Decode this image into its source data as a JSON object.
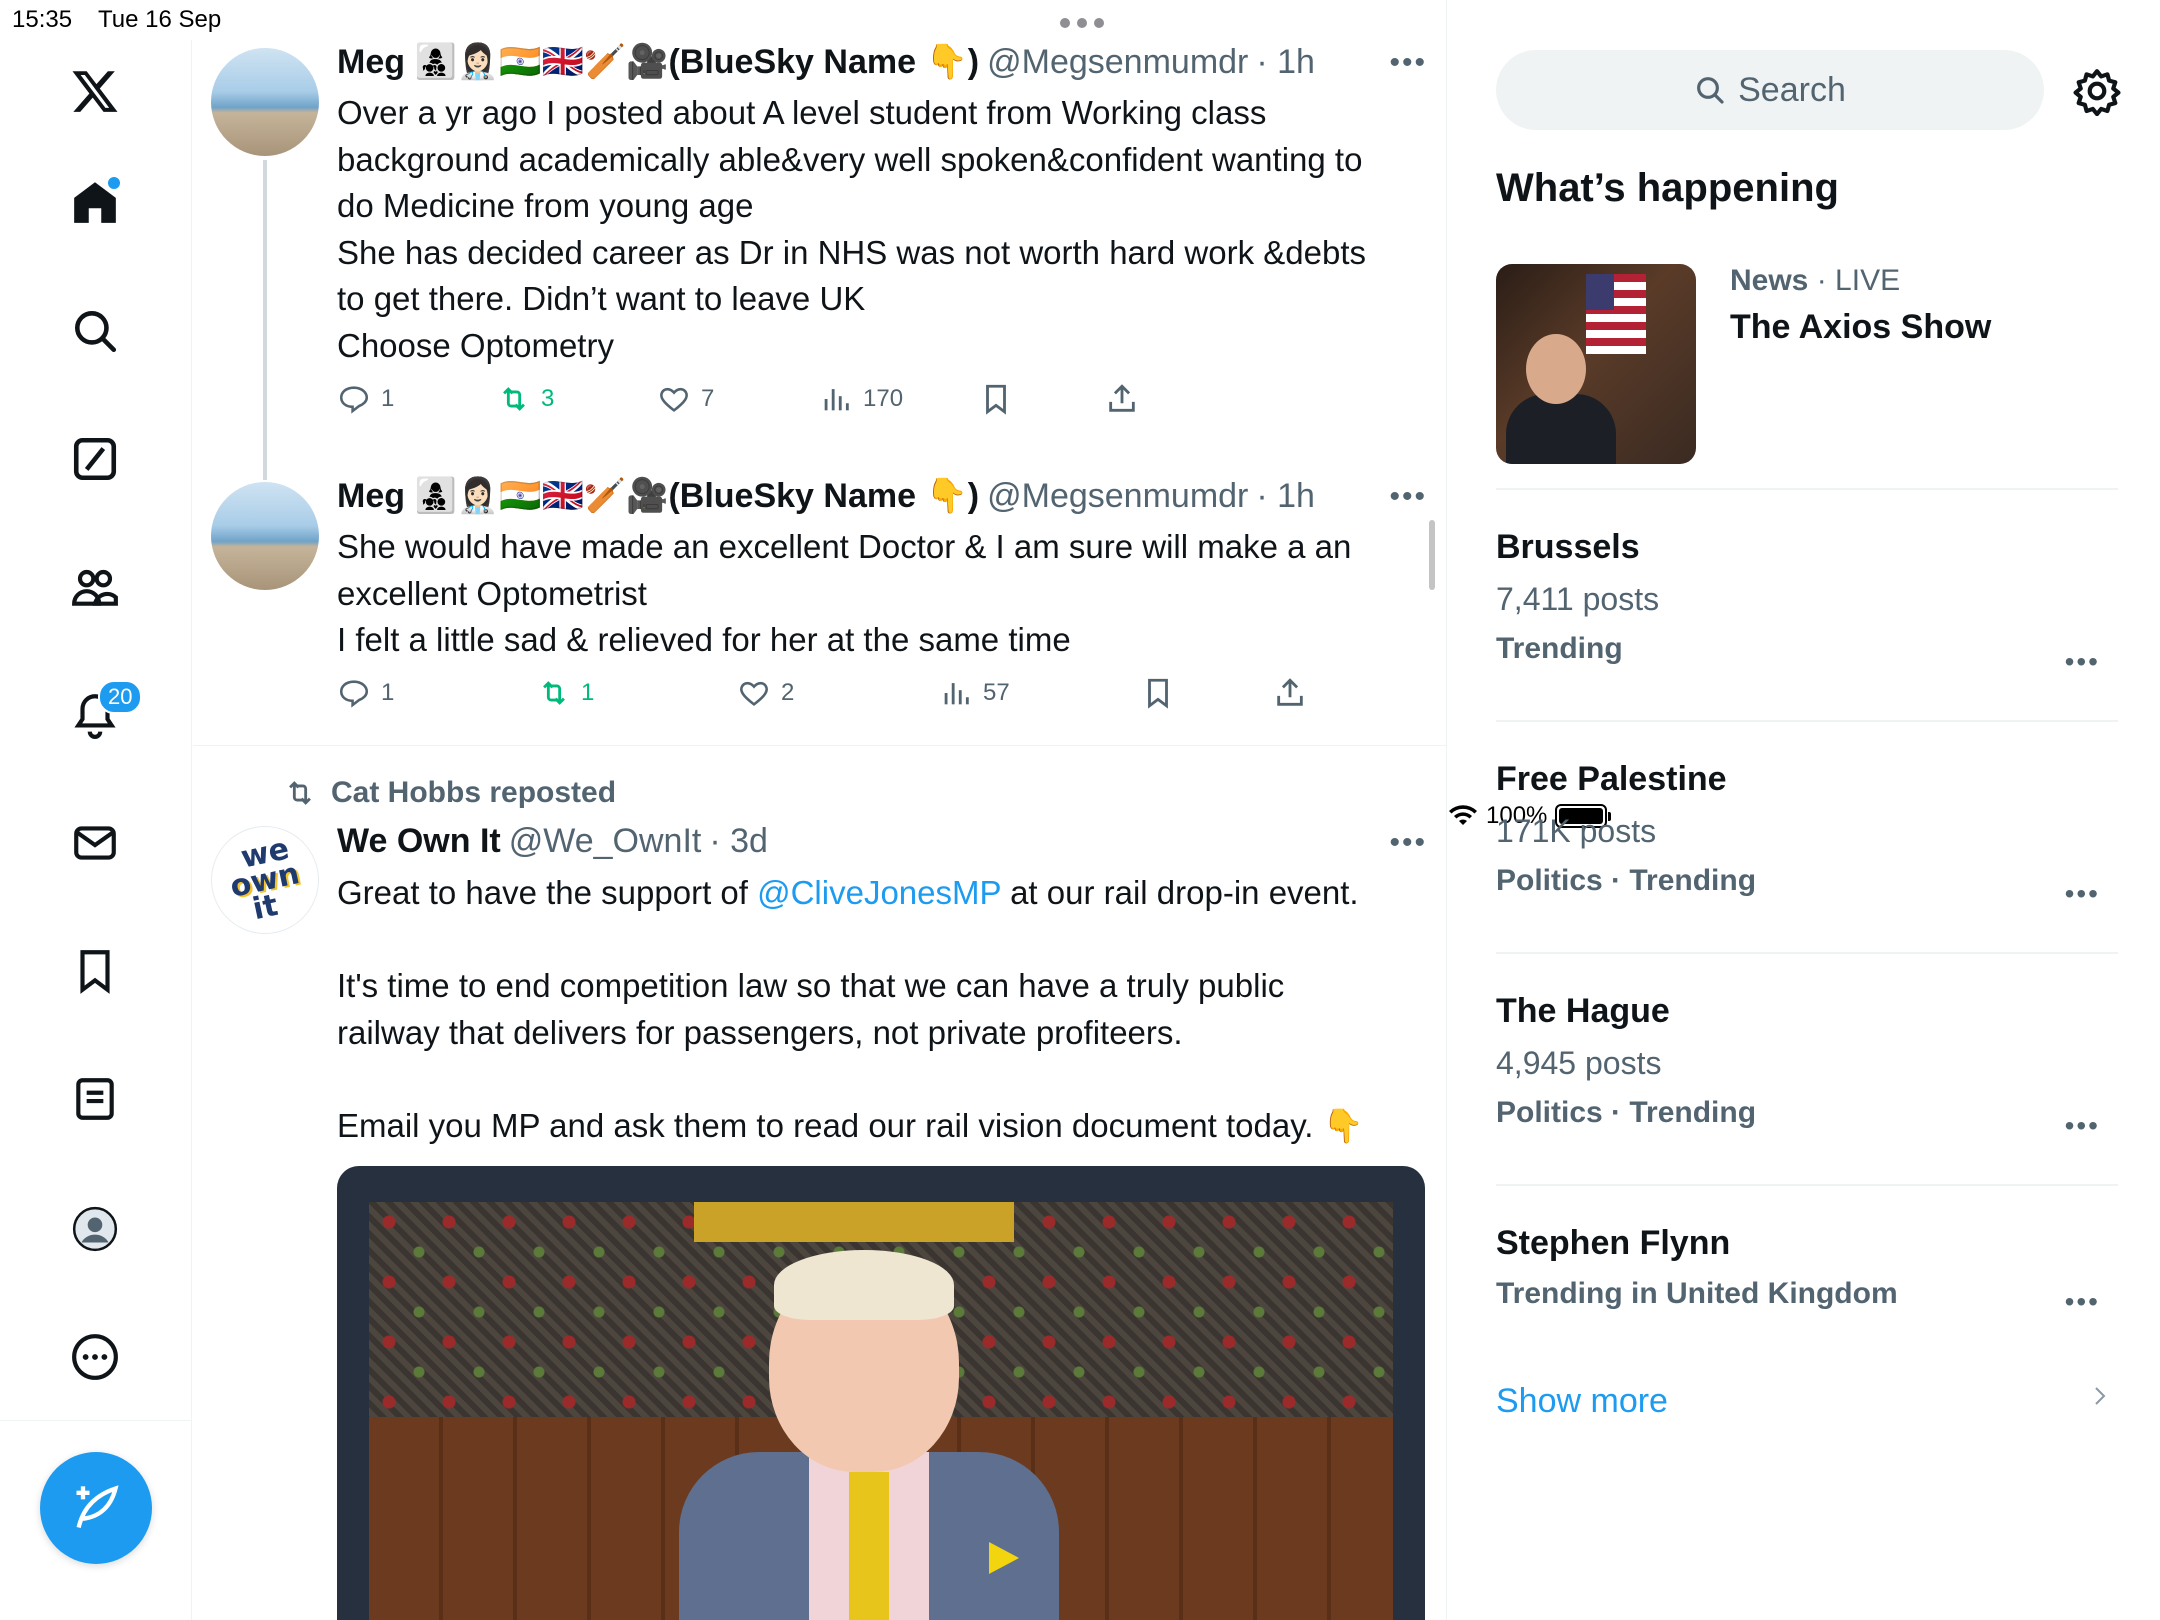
{
  "status_bar": {
    "time": "15:35",
    "date": "Tue 16 Sep",
    "battery": "100%"
  },
  "nav": {
    "notification_badge": "20",
    "icons": [
      "x-logo-icon",
      "home-icon",
      "search-icon",
      "grok-icon",
      "communities-icon",
      "notifications-icon",
      "messages-icon",
      "bookmarks-icon",
      "lists-icon",
      "profile-icon",
      "more-icon",
      "compose-icon"
    ]
  },
  "posts": [
    {
      "name": "Meg 👩‍👧‍👦👩🏻‍⚕️🇮🇳🇬🇧🏏🎥(BlueSky Name 👇)",
      "handle": "@Megsenmumdr",
      "time": "· 1h",
      "lines": [
        "Over a yr ago I posted about A level student from Working class",
        "background academically able&very well spoken&confident wanting to",
        "do Medicine from young age",
        "She has decided career as Dr in NHS was not worth hard work &debts",
        "to get there. Didn’t want to leave UK",
        "Choose Optometry"
      ],
      "replies": "1",
      "reposts": "3",
      "likes": "7",
      "views": "170"
    },
    {
      "name": "Meg 👩‍👧‍👦👩🏻‍⚕️🇮🇳🇬🇧🏏🎥(BlueSky Name 👇)",
      "handle": "@Megsenmumdr",
      "time": "· 1h",
      "lines": [
        "She would have made an excellent Doctor & I am sure will make a an",
        "excellent Optometrist",
        "I felt a little sad & relieved for her at the same time"
      ],
      "replies": "1",
      "reposts": "1",
      "likes": "2",
      "views": "57"
    },
    {
      "repost_label": "Cat Hobbs reposted",
      "name": "We Own It",
      "handle": "@We_OwnIt",
      "time": "· 3d",
      "avatar_text": [
        "we",
        "own",
        "it"
      ],
      "line1_pre": "Great to have the support of ",
      "line1_link": "@CliveJonesMP",
      "line1_post": " at our rail drop-in event.",
      "line2": "It's time to end competition law so that we can have a truly public",
      "line3": "railway that delivers for passengers, not private profiteers.",
      "line4": "Email you MP and ask them to read our rail vision document today.  👇"
    }
  ],
  "sidebar": {
    "search_placeholder": "Search",
    "whats_happening": "What’s happening",
    "news": {
      "category": "News",
      "live": "· LIVE",
      "title": "The Axios Show"
    },
    "trends": [
      {
        "name": "Brussels",
        "count": "7,411 posts",
        "category": "Trending"
      },
      {
        "name": "Free Palestine",
        "count": "171K posts",
        "category": "Politics · Trending"
      },
      {
        "name": "The Hague",
        "count": "4,945 posts",
        "category": "Politics · Trending"
      },
      {
        "name": "Stephen Flynn",
        "category": "Trending in United Kingdom"
      }
    ],
    "show_more": "Show more"
  }
}
